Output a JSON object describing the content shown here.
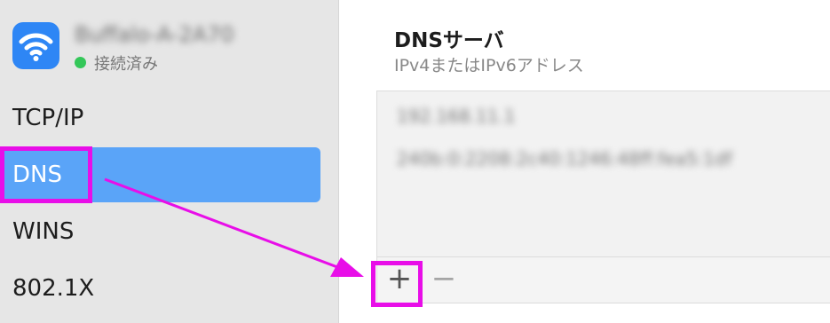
{
  "sidebar": {
    "network": {
      "name": "Buffalo-A-2A70",
      "status": "接続済み"
    },
    "items": [
      {
        "label": "TCP/IP"
      },
      {
        "label": "DNS"
      },
      {
        "label": "WINS"
      },
      {
        "label": "802.1X"
      }
    ],
    "selected": "DNS"
  },
  "main": {
    "title": "DNSサーバ",
    "subtitle": "IPv4またはIPv6アドレス",
    "dns_servers": [
      "192.168.11.1",
      "240b:0:2208:2c40:1246:48ff:fea5:1df"
    ],
    "add_label": "+",
    "remove_label": "−"
  },
  "colors": {
    "accent": "#5aa4f8",
    "highlight": "#e80ee8",
    "status": "#34c759",
    "wifi_tile": "#2e86f5"
  }
}
